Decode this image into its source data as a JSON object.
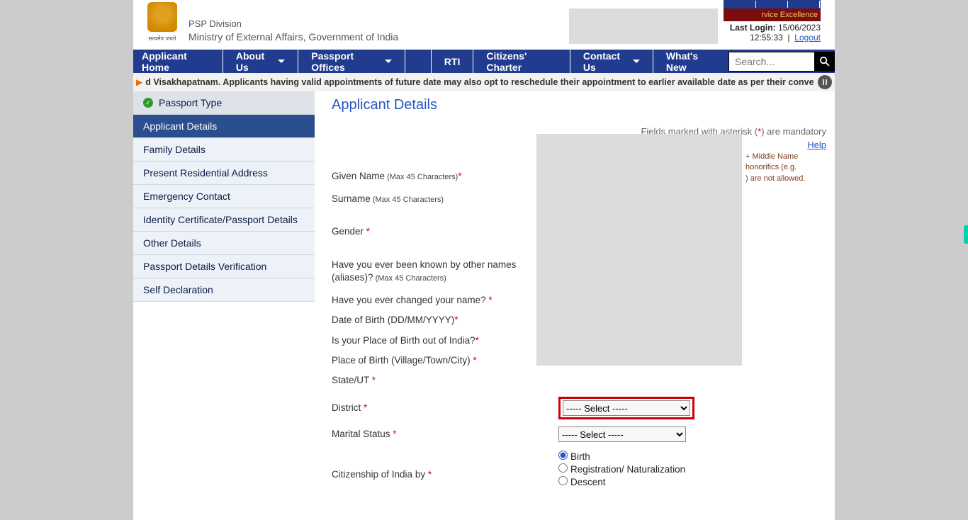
{
  "header": {
    "emblem_caption": "सत्यमेव जयते",
    "division": "PSP Division",
    "ministry": "Ministry of External Affairs, Government of India",
    "badge_text": "rvice Excellence",
    "last_login_label": "Last Login:",
    "last_login_date": "15/06/2023",
    "last_login_time": "12:55:33",
    "logout_label": "Logout"
  },
  "nav": {
    "home": "Applicant Home",
    "about": "About Us",
    "offices": "Passport Offices",
    "rti": "RTI",
    "charter": "Citizens' Charter",
    "contact": "Contact Us",
    "whatsnew": "What's New",
    "search_placeholder": "Search..."
  },
  "ticker": {
    "text": "d Visakhapatnam. Applicants having valid appointments of future date may also opt to reschedule their appointment to earlier available date as per their convenience."
  },
  "sidebar": {
    "items": [
      {
        "label": "Passport Type",
        "state": "completed"
      },
      {
        "label": "Applicant Details",
        "state": "active"
      },
      {
        "label": "Family Details",
        "state": ""
      },
      {
        "label": "Present Residential Address",
        "state": ""
      },
      {
        "label": "Emergency Contact",
        "state": ""
      },
      {
        "label": "Identity Certificate/Passport Details",
        "state": ""
      },
      {
        "label": "Other Details",
        "state": ""
      },
      {
        "label": "Passport Details Verification",
        "state": ""
      },
      {
        "label": "Self Declaration",
        "state": ""
      }
    ]
  },
  "content": {
    "title": "Applicant Details",
    "mandatory_note_pre": "Fields marked with asterisk (",
    "mandatory_note_ast": "*",
    "mandatory_note_post": ") are mandatory",
    "help_label": "Help",
    "hint_line1": "+ Middle Name",
    "hint_line2": "honorifics (e.g.",
    "hint_line3": ") are not allowed."
  },
  "form": {
    "given_name": {
      "label": "Given Name",
      "sub": " (Max 45 Characters)"
    },
    "surname": {
      "label": "Surname",
      "sub": " (Max 45 Characters)"
    },
    "gender": {
      "label": "Gender"
    },
    "aliases": {
      "label": "Have you ever been known by other names (aliases)?",
      "sub": " (Max 45 Characters)"
    },
    "changed_name": {
      "label": "Have you ever changed your name?"
    },
    "dob": {
      "label": "Date of Birth (DD/MM/YYYY)"
    },
    "pob_out": {
      "label": "Is your Place of Birth out of India?"
    },
    "pob": {
      "label": "Place of Birth (Village/Town/City)"
    },
    "state": {
      "label": "State/UT"
    },
    "district": {
      "label": "District",
      "placeholder": "----- Select -----"
    },
    "marital": {
      "label": "Marital Status",
      "placeholder": "----- Select -----"
    },
    "citizenship": {
      "label": "Citizenship of India by",
      "options": {
        "birth": "Birth",
        "reg": "Registration/ Naturalization",
        "descent": "Descent"
      },
      "selected": "birth"
    }
  }
}
